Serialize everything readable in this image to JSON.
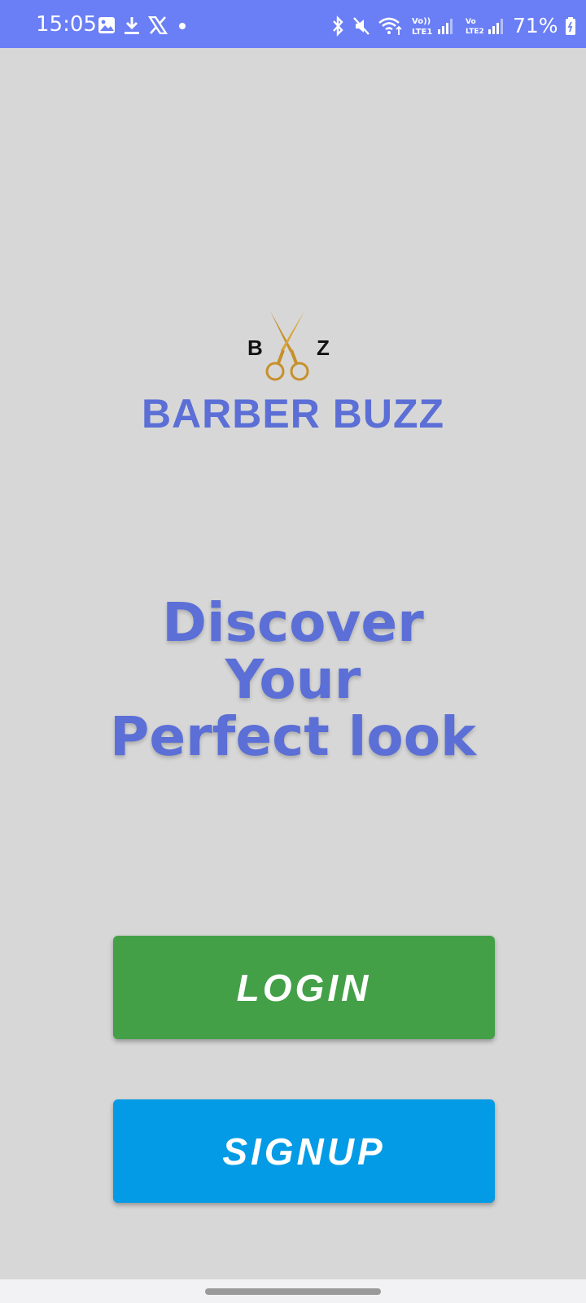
{
  "status_bar": {
    "time": "15:05",
    "battery": "71%",
    "left_icons": [
      "gallery-icon",
      "download-icon",
      "x-app-icon",
      "notification-dot-icon"
    ],
    "right_icons": [
      "bluetooth-icon",
      "mute-icon",
      "wifi-icon",
      "signal-sim1-icon",
      "signal-sim2-icon",
      "battery-icon"
    ],
    "sim1_label": "LTE1",
    "sim1_volte": "Vo))",
    "sim2_label": "LTE2",
    "sim2_volte": "Vo",
    "color": "#6a7ef5"
  },
  "logo": {
    "letter_left": "B",
    "letter_right": "Z",
    "icon": "scissors-icon",
    "brand_name": "BARBER BUZZ"
  },
  "tagline": {
    "line1": "Discover",
    "line2": "Your",
    "line3": "Perfect look"
  },
  "buttons": {
    "login": "LOGIN",
    "signup": "SIGNUP"
  },
  "colors": {
    "background": "#d7d7d7",
    "brand": "#5b6fd6",
    "login": "#43a047",
    "signup": "#039be5",
    "scissors": "#c8902a"
  }
}
